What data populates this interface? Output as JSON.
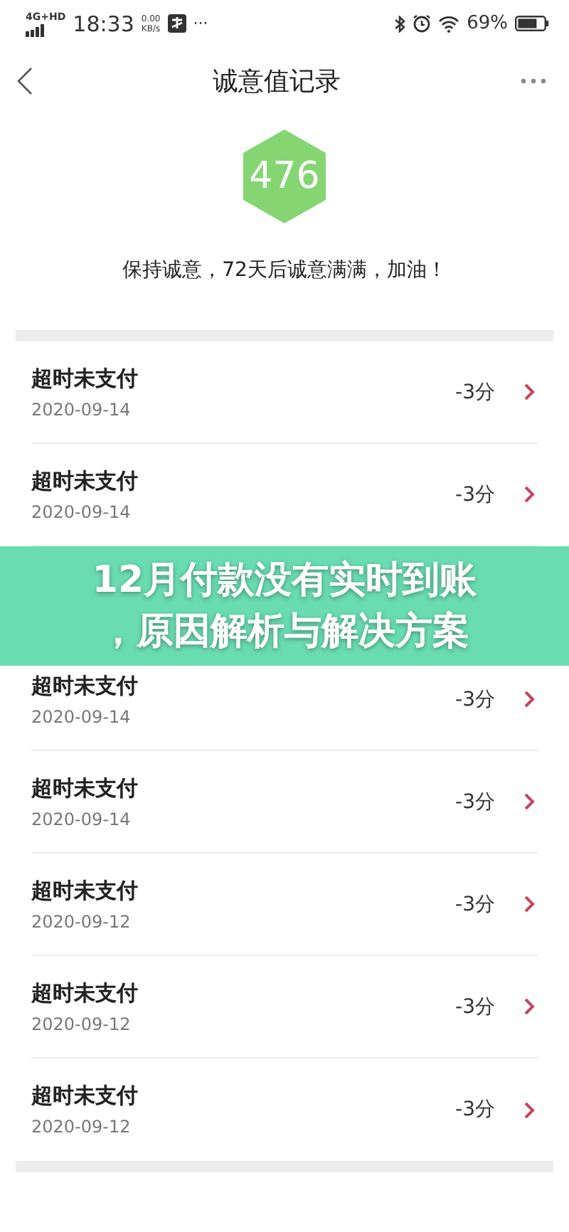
{
  "status_bar": {
    "network": "4G+HD",
    "time": "18:33",
    "speed": "0.00",
    "speed_unit": "KB/s",
    "more": "···",
    "battery": "69%"
  },
  "nav": {
    "title": "诚意值记录"
  },
  "score": {
    "value": "476",
    "message": "保持诚意，72天后诚意满满，加油！"
  },
  "records": [
    {
      "title": "超时未支付",
      "date": "2020-09-14",
      "points": "-3分"
    },
    {
      "title": "超时未支付",
      "date": "2020-09-14",
      "points": "-3分"
    },
    {
      "title": "超时未支付",
      "date": "2020-09-14",
      "points": "-3分"
    },
    {
      "title": "超时未支付",
      "date": "2020-09-14",
      "points": "-3分"
    },
    {
      "title": "超时未支付",
      "date": "2020-09-12",
      "points": "-3分"
    },
    {
      "title": "超时未支付",
      "date": "2020-09-12",
      "points": "-3分"
    },
    {
      "title": "超时未支付",
      "date": "2020-09-12",
      "points": "-3分"
    }
  ],
  "banner": {
    "lines": [
      "12月付款没有实时到账",
      "，原因解析与解决方案"
    ]
  }
}
